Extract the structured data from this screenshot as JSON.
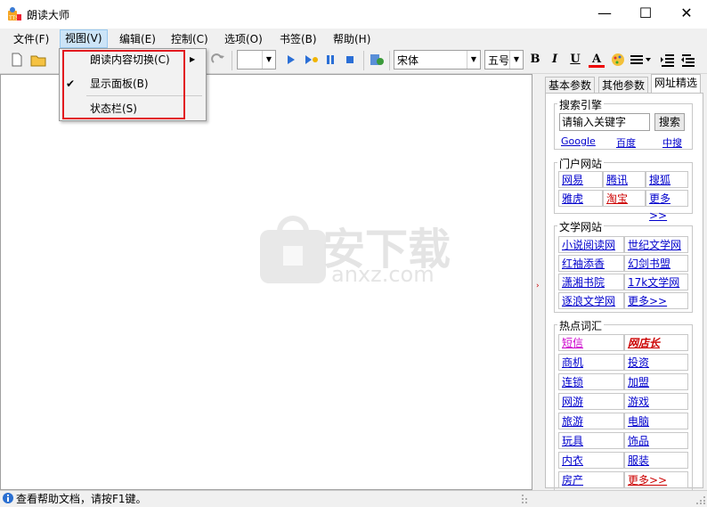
{
  "window": {
    "title": "朗读大师",
    "minimize": "—",
    "maximize": "☐",
    "close": "✕"
  },
  "menubar": {
    "items": [
      "文件(F)",
      "视图(V)",
      "编辑(E)",
      "控制(C)",
      "选项(O)",
      "书签(B)",
      "帮助(H)"
    ]
  },
  "view_menu": {
    "items": [
      {
        "label": "朗读内容切换(C)",
        "has_submenu": true,
        "checked": false
      },
      {
        "label": "显示面板(B)",
        "has_submenu": false,
        "checked": true
      },
      {
        "label": "状态栏(S)",
        "has_submenu": false,
        "checked": false
      }
    ],
    "submenu_arrow": "▶",
    "check_mark": "✔"
  },
  "toolbar": {
    "font": "宋体",
    "size": "五号",
    "bold": "B",
    "italic": "I",
    "underline": "U",
    "font_color": "A",
    "combo_arrow": "▼"
  },
  "panel": {
    "tabs": [
      "基本参数",
      "其他参数",
      "网址精选"
    ],
    "active_tab": 2,
    "search": {
      "group": "搜索引擎",
      "placeholder": "请输入关键字",
      "button": "搜索",
      "engines": [
        "Google",
        "百度",
        "中搜"
      ]
    },
    "portal": {
      "group": "门户网站",
      "links": [
        "网易",
        "腾讯",
        "搜狐",
        "雅虎",
        "淘宝",
        "更多>>"
      ]
    },
    "literature": {
      "group": "文学网站",
      "links": [
        "小说阅读网",
        "世纪文学网",
        "红袖添香",
        "幻剑书盟",
        "潇湘书院",
        "17k文学网",
        "逐浪文学网",
        "更多>>"
      ]
    },
    "hot": {
      "group": "热点词汇",
      "links": [
        "短信",
        "网店长",
        "商机",
        "投资",
        "连锁",
        "加盟",
        "网游",
        "游戏",
        "旅游",
        "电脑",
        "玩具",
        "饰品",
        "内衣",
        "服装",
        "房产",
        "更多>>"
      ]
    },
    "splitter_arrow": "›"
  },
  "watermark": {
    "text": "安下载",
    "sub": "anxz.com"
  },
  "status": {
    "text": "查看帮助文档，请按F1键。"
  },
  "colors": {
    "highlight_box": "#e2191f",
    "link": "#0000cc",
    "red_link": "#cc0000",
    "magenta_link": "#cc00cc"
  }
}
